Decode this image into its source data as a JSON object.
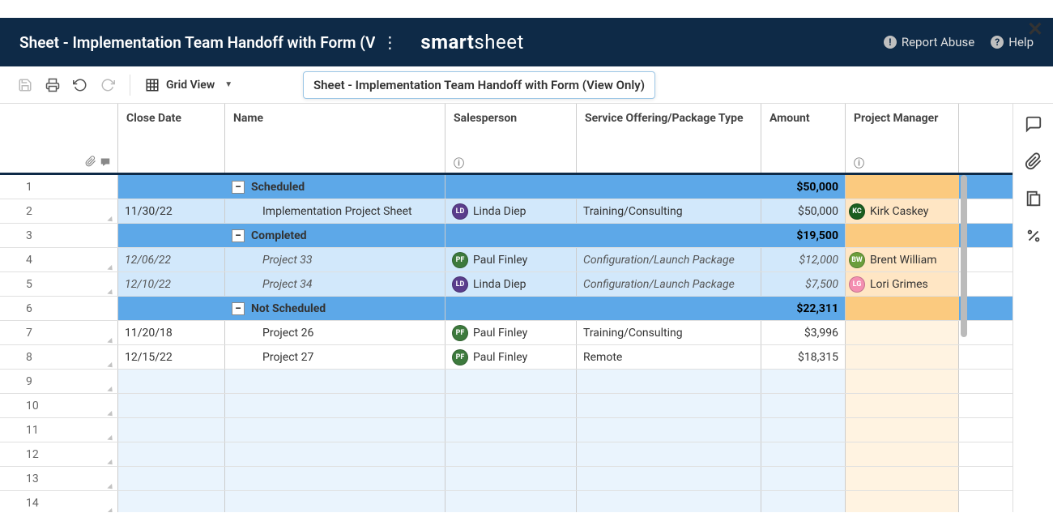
{
  "modal": {
    "close": "✕"
  },
  "header": {
    "title": "Sheet - Implementation Team Handoff with Form (V",
    "brand_a": "smart",
    "brand_b": "sheet",
    "report_abuse": "Report Abuse",
    "help": "Help"
  },
  "toolbar": {
    "grid_view": "Grid View",
    "tooltip": "Sheet - Implementation Team Handoff with Form (View Only)"
  },
  "columns": {
    "close_date": "Close Date",
    "name": "Name",
    "salesperson": "Salesperson",
    "service": "Service Offering/Package Type",
    "amount": "Amount",
    "pm": "Project Manager"
  },
  "groups": {
    "scheduled": {
      "label": "Scheduled",
      "amount": "$50,000"
    },
    "completed": {
      "label": "Completed",
      "amount": "$19,500"
    },
    "not_scheduled": {
      "label": "Not Scheduled",
      "amount": "$22,311"
    }
  },
  "rows": [
    {
      "num": "1"
    },
    {
      "num": "2",
      "close": "11/30/22",
      "name": "Implementation Project Sheet",
      "sales_init": "LD",
      "sales": "Linda Diep",
      "service": "Training/Consulting",
      "amount": "$50,000",
      "pm_init": "KC",
      "pm": "Kirk Caskey"
    },
    {
      "num": "3"
    },
    {
      "num": "4",
      "close": "12/06/22",
      "name": "Project 33",
      "sales_init": "PF",
      "sales": "Paul Finley",
      "service": "Configuration/Launch Package",
      "amount": "$12,000",
      "pm_init": "BW",
      "pm": "Brent William"
    },
    {
      "num": "5",
      "close": "12/10/22",
      "name": "Project 34",
      "sales_init": "LD",
      "sales": "Linda Diep",
      "service": "Configuration/Launch Package",
      "amount": "$7,500",
      "pm_init": "LG",
      "pm": "Lori Grimes"
    },
    {
      "num": "6"
    },
    {
      "num": "7",
      "close": "11/20/18",
      "name": "Project 26",
      "sales_init": "PF",
      "sales": "Paul Finley",
      "service": "Training/Consulting",
      "amount": "$3,996"
    },
    {
      "num": "8",
      "close": "12/15/22",
      "name": "Project 27",
      "sales_init": "PF",
      "sales": "Paul Finley",
      "service": "Remote",
      "amount": "$18,315"
    },
    {
      "num": "9"
    },
    {
      "num": "10"
    },
    {
      "num": "11"
    },
    {
      "num": "12"
    },
    {
      "num": "13"
    },
    {
      "num": "14"
    }
  ]
}
